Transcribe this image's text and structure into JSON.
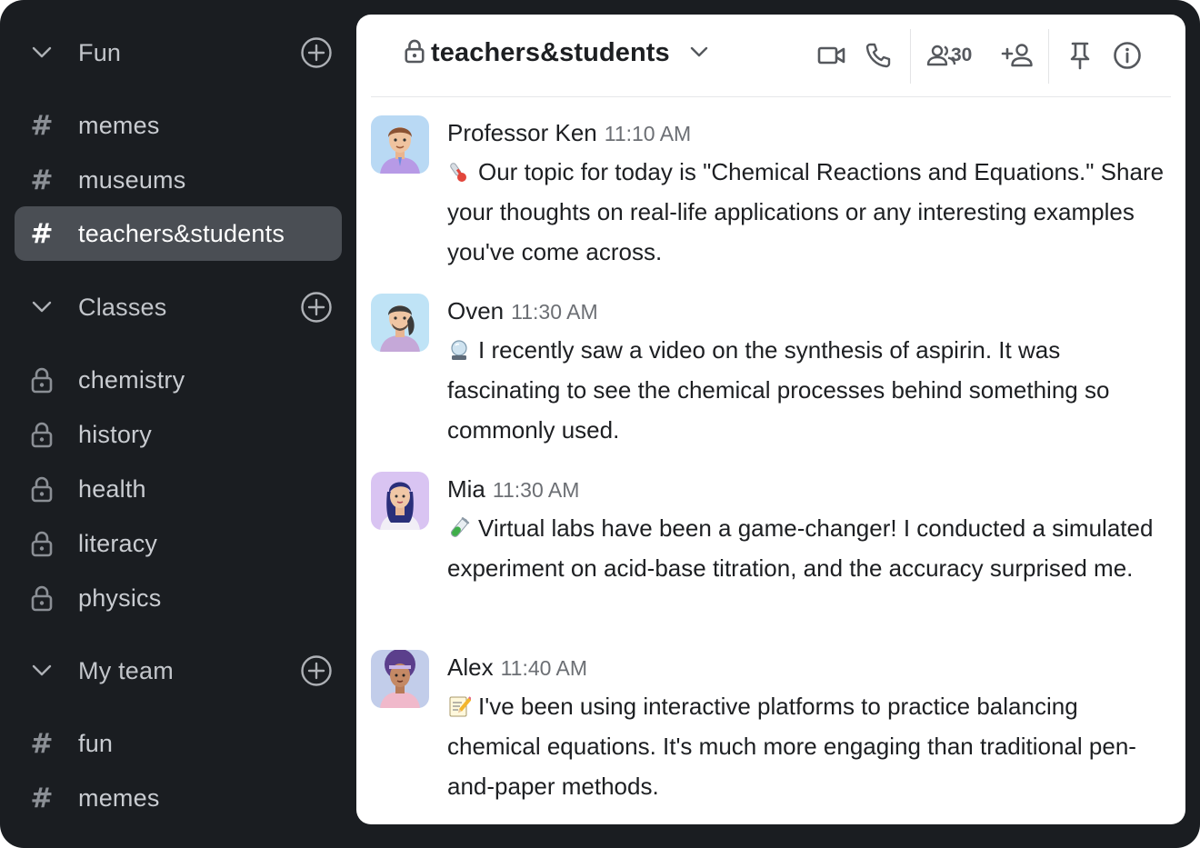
{
  "sidebar": {
    "sections": [
      {
        "label": "Fun",
        "channels": [
          {
            "label": "memes",
            "type": "public"
          },
          {
            "label": "museums",
            "type": "public"
          },
          {
            "label": "teachers&students",
            "type": "public",
            "active": true
          }
        ]
      },
      {
        "label": "Classes",
        "channels": [
          {
            "label": "chemistry",
            "type": "private"
          },
          {
            "label": "history",
            "type": "private"
          },
          {
            "label": "health",
            "type": "private"
          },
          {
            "label": "literacy",
            "type": "private"
          },
          {
            "label": "physics",
            "type": "private"
          }
        ]
      },
      {
        "label": "My team",
        "channels": [
          {
            "label": "fun",
            "type": "public"
          },
          {
            "label": "memes",
            "type": "public"
          }
        ]
      }
    ],
    "hash_symbol": "#"
  },
  "header": {
    "channel_name": "teachers&students",
    "member_count": "30"
  },
  "messages": [
    {
      "author": "Professor Ken",
      "time": "11:10 AM",
      "emoji": "thermometer",
      "text": "Our topic for today is \"Chemical Reactions and Equations.\" Share your thoughts on real-life applications or any interesting examples you've come across."
    },
    {
      "author": "Oven",
      "time": "11:30 AM",
      "emoji": "crystal-ball",
      "text": "I recently saw a video on the synthesis of aspirin. It was fascinating to see the chemical processes behind something so commonly used."
    },
    {
      "author": "Mia",
      "time": "11:30 AM",
      "emoji": "test-tube",
      "text": "Virtual labs have been a game-changer! I conducted a simulated experiment on acid-base titration, and the accuracy surprised me."
    },
    {
      "author": "Alex",
      "time": "11:40 AM",
      "emoji": "memo",
      "text": "I've been using interactive platforms to practice balancing chemical equations. It's much more engaging than traditional pen-and-paper methods."
    }
  ],
  "colors": {
    "sidebar_bg": "#1a1d21",
    "active_item_bg": "#4a4e54",
    "main_bg": "#ffffff"
  }
}
